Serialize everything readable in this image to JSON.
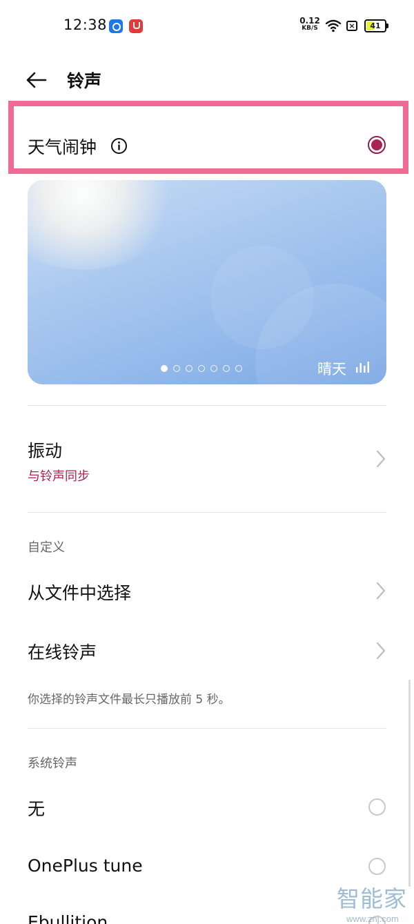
{
  "status_bar": {
    "time": "12:38",
    "net_speed_value": "0.12",
    "net_speed_unit": "KB/S",
    "sim_label": "×",
    "battery_level": "41",
    "battery_fraction": 0.41,
    "battery_fill_color": "#e8f23c",
    "icons": [
      "app-blue-icon",
      "app-red-icon",
      "wifi-icon",
      "sim-icon",
      "battery-icon"
    ]
  },
  "header": {
    "back_icon": "arrow-left-icon",
    "title": "铃声"
  },
  "selected_ringtone": {
    "label": "天气闹钟",
    "info_icon": "info-icon",
    "selected": true,
    "highlight_color": "#ee6b94",
    "radio_color": "#a8234f"
  },
  "weather_preview": {
    "condition": "晴天",
    "signal_icon": "sound-bars-icon",
    "page_count": 7,
    "active_page": 0
  },
  "vibration": {
    "title": "振动",
    "subtitle": "与铃声同步",
    "subtitle_color": "#a8234f"
  },
  "custom_section": {
    "header": "自定义",
    "items": [
      {
        "label": "从文件中选择"
      },
      {
        "label": "在线铃声"
      }
    ],
    "hint": "你选择的铃声文件最长只播放前 5 秒。"
  },
  "system_section": {
    "header": "系统铃声",
    "items": [
      {
        "label": "无",
        "selected": false
      },
      {
        "label": "OnePlus tune",
        "selected": false
      },
      {
        "label": "Ebullition",
        "selected": false
      }
    ]
  },
  "watermark": {
    "logo": "智能家",
    "url": "www.znj.com"
  }
}
